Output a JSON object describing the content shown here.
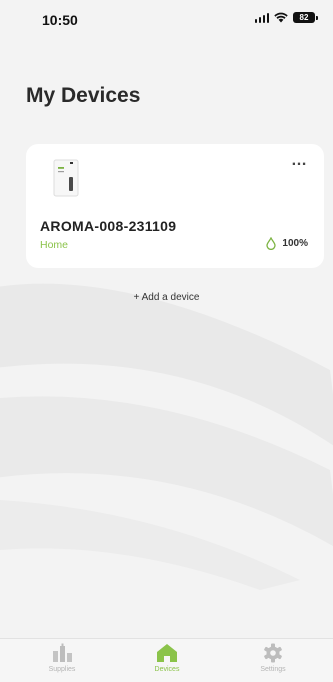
{
  "status_bar": {
    "time": "10:50",
    "battery": "82"
  },
  "page": {
    "title": "My Devices"
  },
  "devices": [
    {
      "name": "AROMA-008-231109",
      "location": "Home",
      "level": "100%",
      "more": "…"
    }
  ],
  "actions": {
    "add_device": "+ Add a device"
  },
  "tabs": [
    {
      "label": "Supplies",
      "icon": "supplies-icon",
      "active": false
    },
    {
      "label": "Devices",
      "icon": "home-icon",
      "active": true
    },
    {
      "label": "Settings",
      "icon": "gear-icon",
      "active": false
    }
  ],
  "colors": {
    "accent": "#8bc34a",
    "background": "#f3f3f3",
    "card": "#ffffff",
    "inactive_tab": "#b5b5b5"
  }
}
